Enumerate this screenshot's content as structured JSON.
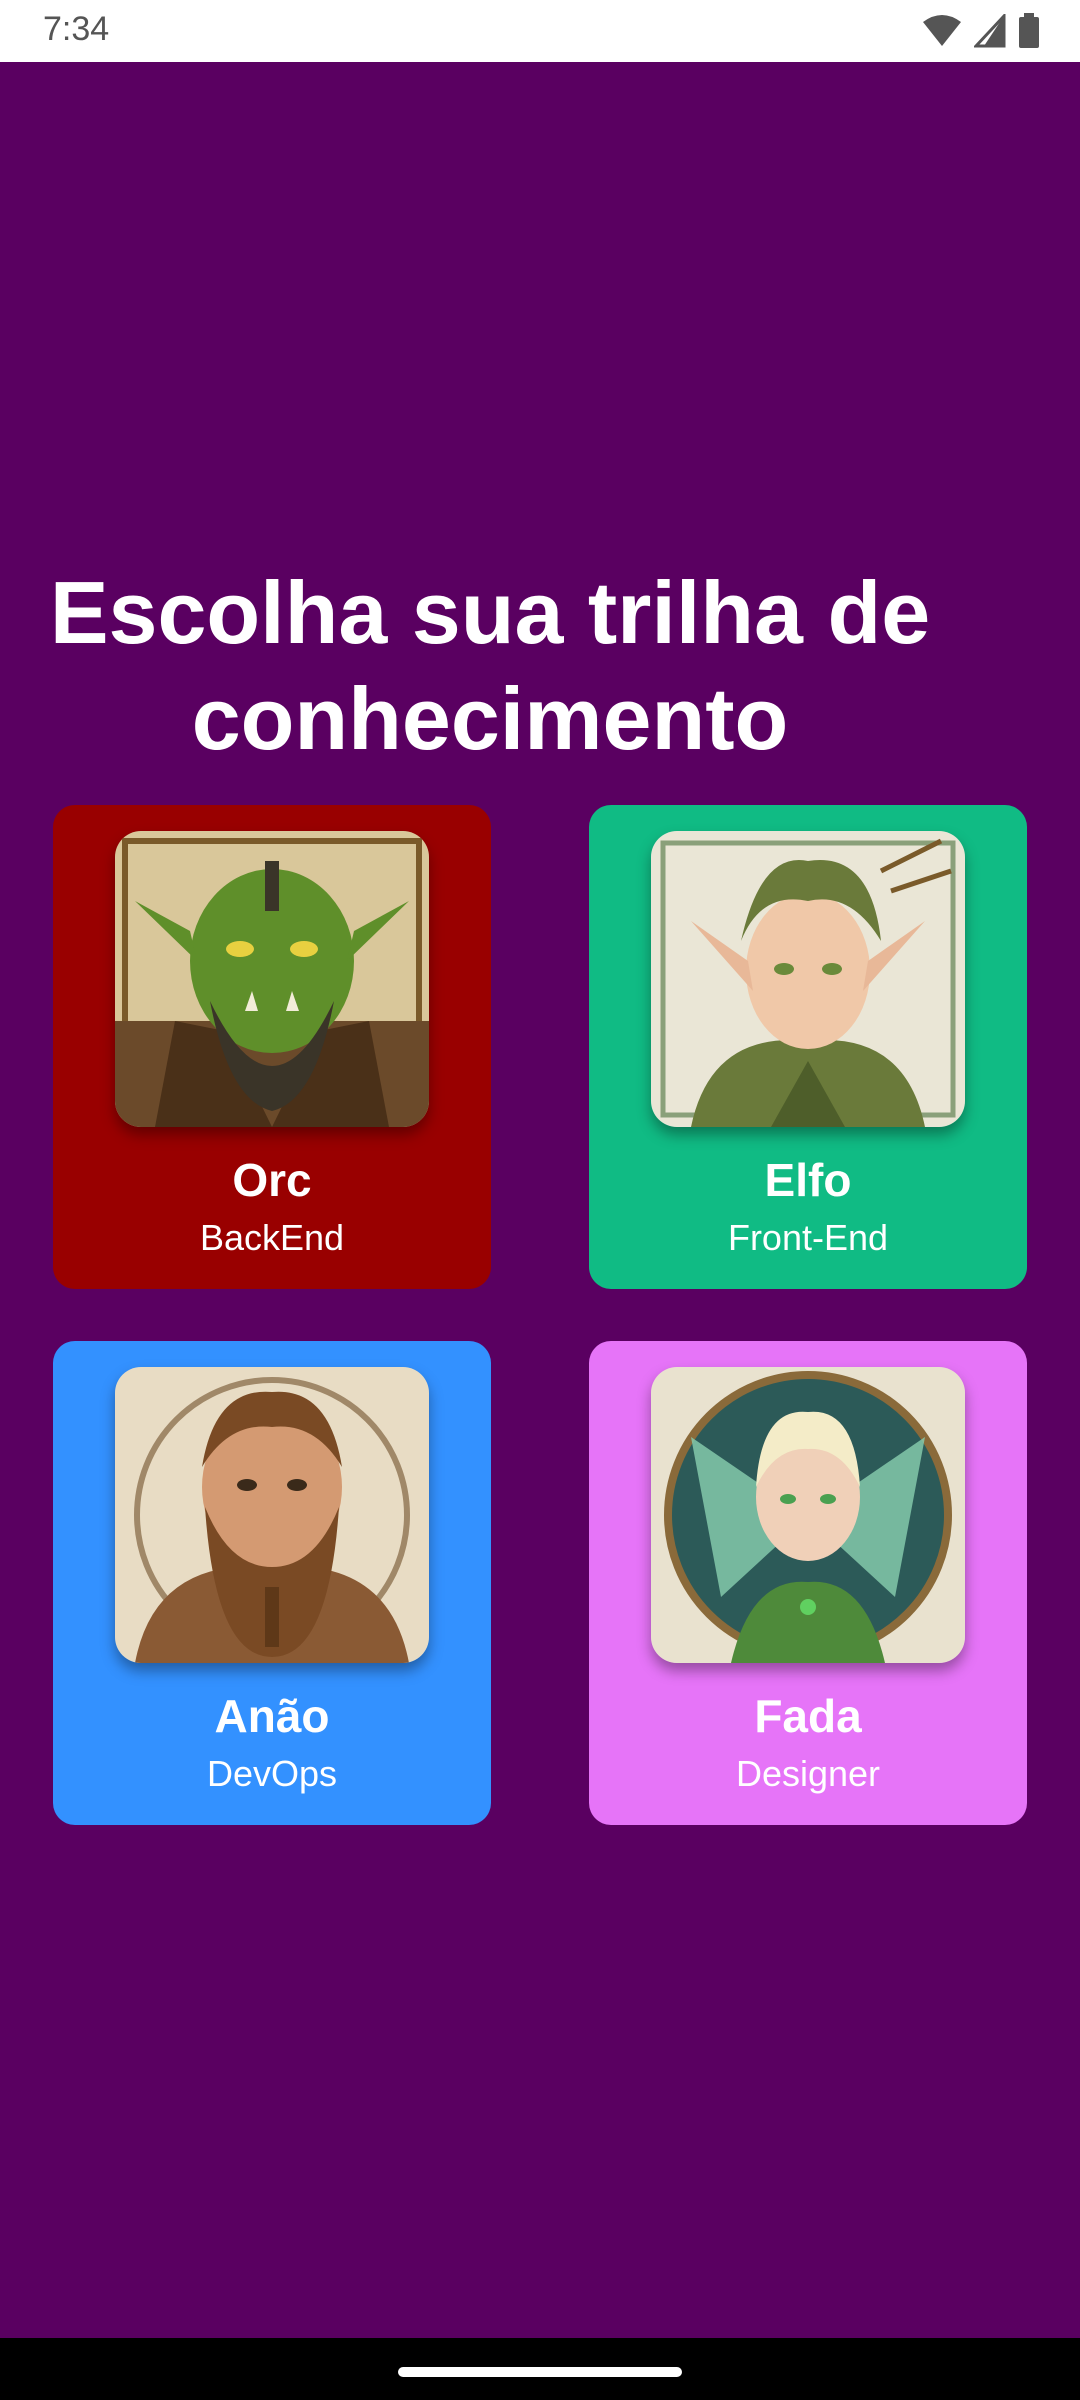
{
  "status": {
    "time": "7:34",
    "icons": [
      "wifi-icon",
      "cell-signal-icon",
      "battery-icon"
    ]
  },
  "title": {
    "line1": "Escolha sua trilha de",
    "line2": "conhecimento"
  },
  "cards": [
    {
      "name": "Orc",
      "role": "BackEnd",
      "color": "#990000",
      "portrait": "orc-portrait"
    },
    {
      "name": "Elfo",
      "role": "Front-End",
      "color": "#10bb84",
      "portrait": "elf-portrait"
    },
    {
      "name": "Anão",
      "role": "DevOps",
      "color": "#3391ff",
      "portrait": "dwarf-portrait"
    },
    {
      "name": "Fada",
      "role": "Designer",
      "color": "#e674f8",
      "portrait": "fairy-portrait"
    }
  ],
  "colors": {
    "background": "#5a0061",
    "status_bar": "#ffffff",
    "nav_bar": "#000000"
  }
}
